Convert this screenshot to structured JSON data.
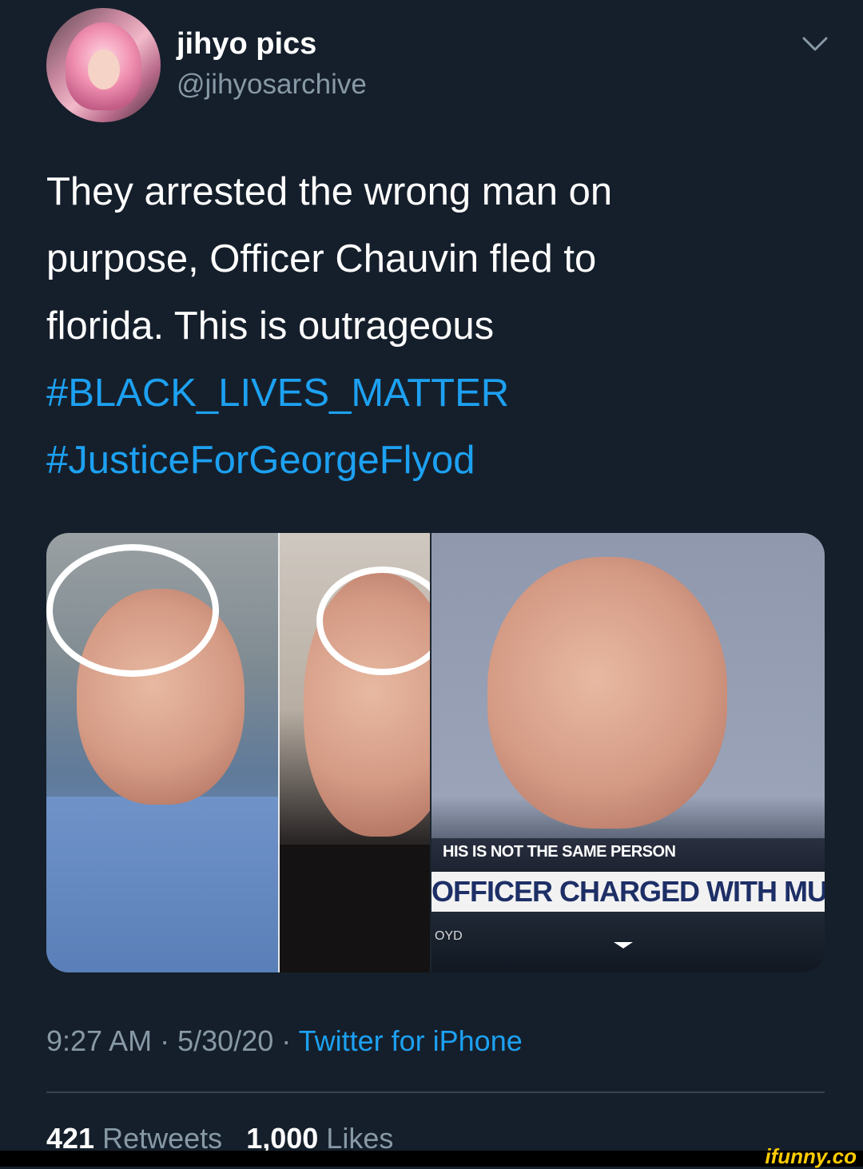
{
  "user": {
    "display_name": "jihyo pics",
    "handle": "@jihyosarchive",
    "avatar_icon": "profile-avatar"
  },
  "tweet": {
    "lines": [
      "They arrested the wrong man on",
      "purpose, Officer Chauvin fled to",
      "florida. This is outrageous"
    ],
    "hashtags": [
      "#BLACK_LIVES_MATTER",
      "#JusticeForGeorgeFlyod"
    ]
  },
  "media": {
    "caption_top": "HIS IS NOT THE SAME PERSON",
    "caption_headline": "OFFICER CHARGED WITH MU",
    "caption_small": "OYD"
  },
  "meta": {
    "time": "9:27 AM",
    "date": "5/30/20",
    "separator": "·",
    "source": "Twitter for iPhone"
  },
  "stats": {
    "retweets_count": "421",
    "retweets_label": "Retweets",
    "likes_count": "1,000",
    "likes_label": "Likes"
  },
  "watermark": "ifunny.co",
  "colors": {
    "background": "#151f2b",
    "accent": "#1da1f2",
    "secondary_text": "#8899a6",
    "watermark": "#ffcc00"
  }
}
